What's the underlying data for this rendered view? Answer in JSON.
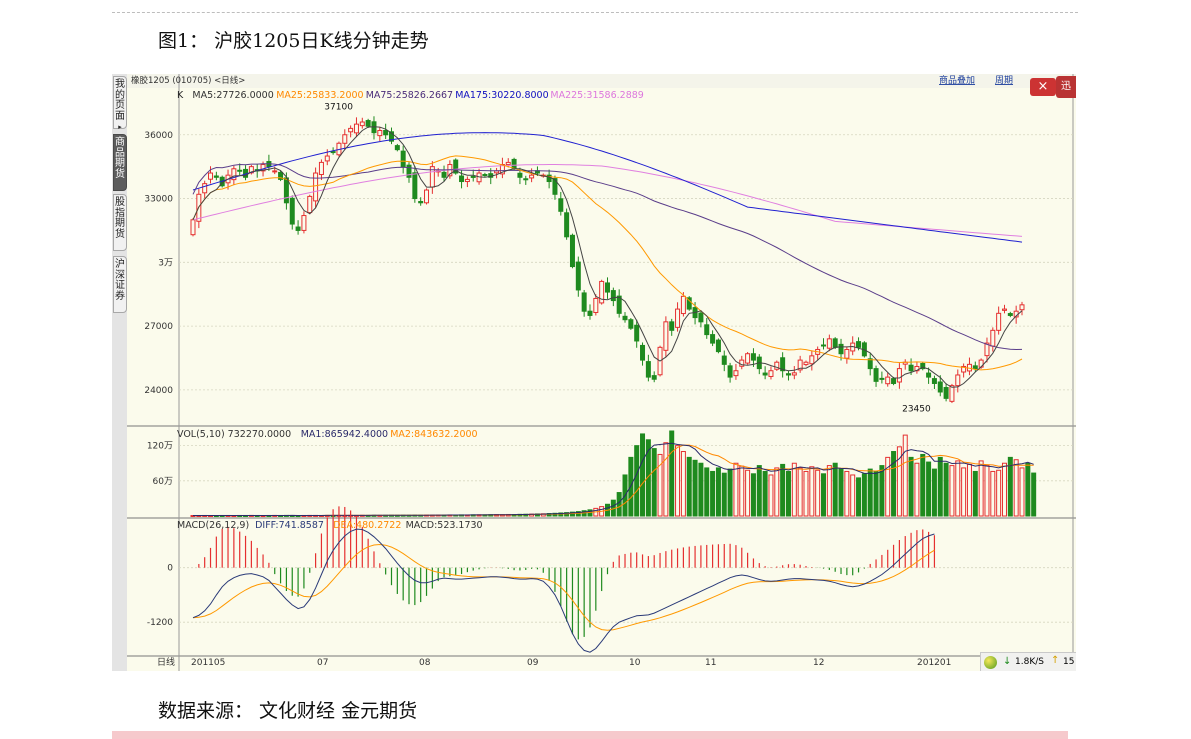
{
  "figure_title": "图1：  沪胶1205日K线分钟走势",
  "source_text": "数据来源：  文化财经    金元期货",
  "window": {
    "title": "橡胶1205 (010705) <日线>",
    "menu": [
      "商品叠加",
      "周期"
    ],
    "close_label": "×",
    "side_label": "迅"
  },
  "left_tabs": [
    {
      "label": "我的页面",
      "active": false,
      "arrow": "▸"
    },
    {
      "label": "商品期货",
      "active": true,
      "arrow": ""
    },
    {
      "label": "股指期货",
      "active": false,
      "arrow": ""
    },
    {
      "label": "沪深证券",
      "active": false,
      "arrow": ""
    }
  ],
  "status": {
    "speed": "1.8K/S",
    "up": "15",
    "down_arrow": "↓",
    "up_arrow": "↑"
  },
  "colors": {
    "up": "#e53030",
    "down": "#1f8a1f",
    "ma5": "#444444",
    "ma25": "#ff9900",
    "ma75": "#5a3d8a",
    "ma175": "#2020d0",
    "ma225": "#e080e0",
    "diff": "#2a3a78",
    "dea": "#ff9900",
    "background": "#fbfbec"
  },
  "chart_data": [
    {
      "type": "candlestick",
      "title": "",
      "legend": [
        {
          "prefix": "K",
          "name": "",
          "color": "#222222"
        },
        {
          "name": "MA5:27726.0000",
          "color": "#333333"
        },
        {
          "name": "MA25:25833.2000",
          "color": "#ff8800"
        },
        {
          "name": "MA75:25826.2667",
          "color": "#4b2d7a"
        },
        {
          "name": "MA175:30220.8000",
          "color": "#1010c0"
        },
        {
          "name": "MA225:31586.2889",
          "color": "#dd77dd"
        }
      ],
      "y_ticks": [
        "36000",
        "33000",
        "3万",
        "27000",
        "24000"
      ],
      "ylim": [
        22300,
        38200
      ],
      "annotations": [
        "37100",
        "23450"
      ],
      "high": 37100,
      "low": 23450,
      "closes": [
        32000,
        33200,
        33700,
        34200,
        34000,
        33600,
        34100,
        34400,
        34300,
        34000,
        34500,
        34300,
        34600,
        34500,
        34300,
        33900,
        32800,
        31800,
        31500,
        32200,
        33100,
        34200,
        34700,
        35000,
        35200,
        35600,
        36000,
        36300,
        36500,
        36600,
        36400,
        36100,
        36200,
        36000,
        35700,
        35300,
        34500,
        34000,
        33000,
        32800,
        33400,
        34500,
        34300,
        34000,
        34600,
        34200,
        33800,
        33900,
        34000,
        34200,
        34100,
        34000,
        34300,
        34600,
        34700,
        34400,
        34000,
        33900,
        34100,
        34200,
        34100,
        33800,
        33200,
        32400,
        31200,
        29800,
        28700,
        27700,
        27500,
        28300,
        29100,
        28600,
        28200,
        27600,
        27300,
        26900,
        26300,
        25400,
        24600,
        24500,
        26000,
        27200,
        26800,
        27800,
        28400,
        27800,
        27400,
        27200,
        26600,
        26200,
        25800,
        25200,
        24600,
        24900,
        25400,
        25700,
        25400,
        25000,
        24700,
        24900,
        25300,
        24900,
        24700,
        24800,
        25400,
        25300,
        25600,
        25900,
        26100,
        26400,
        26000,
        25700,
        25900,
        26200,
        26000,
        25600,
        25000,
        24400,
        24500,
        24600,
        24300,
        25000,
        25300,
        24900,
        25100,
        25000,
        24600,
        24300,
        23900,
        23600,
        24200,
        24700,
        25100,
        25200,
        25000,
        25400,
        26200,
        26800,
        27600,
        27800,
        27500,
        27700,
        28000
      ]
    },
    {
      "type": "bar",
      "title": "",
      "legend": [
        {
          "name": "VOL(5,10) 732270.0000",
          "color": "#333333"
        },
        {
          "name": "MA1:865942.4000",
          "color": "#2a2a6a"
        },
        {
          "name": "MA2:843632.2000",
          "color": "#ff8800"
        }
      ],
      "y_ticks": [
        "120万",
        "60万"
      ],
      "ylim": [
        0,
        1450000
      ],
      "values": [
        8000,
        8000,
        9000,
        8000,
        8000,
        9000,
        9000,
        8000,
        9000,
        9000,
        10000,
        9000,
        8000,
        9000,
        10000,
        9000,
        10000,
        9000,
        8000,
        9000,
        10000,
        10000,
        9000,
        10000,
        10000,
        11000,
        10000,
        11000,
        10000,
        12000,
        11000,
        12000,
        11000,
        12000,
        13000,
        12000,
        14000,
        13000,
        15000,
        14000,
        16000,
        15000,
        17000,
        16000,
        18000,
        17000,
        19000,
        18000,
        20000,
        21000,
        20000,
        22000,
        24000,
        23000,
        26000,
        25000,
        28000,
        30000,
        32000,
        35000,
        38000,
        42000,
        46000,
        52000,
        58000,
        66000,
        75000,
        90000,
        105000,
        130000,
        160000,
        200000,
        270000,
        400000,
        700000,
        1000000,
        1200000,
        1400000,
        1300000,
        1150000,
        1050000,
        1250000,
        1450000,
        1200000,
        1100000,
        1000000,
        950000,
        900000,
        820000,
        760000,
        820000,
        730000,
        800000,
        900000,
        850000,
        780000,
        720000,
        860000,
        760000,
        700000,
        820000,
        880000,
        760000,
        900000,
        820000,
        760000,
        840000,
        780000,
        720000,
        860000,
        900000,
        800000,
        760000,
        700000,
        650000,
        720000,
        800000,
        760000,
        860000,
        1000000,
        1100000,
        1180000,
        1380000,
        1000000,
        900000,
        1050000,
        920000,
        800000,
        1000000,
        900000,
        860000,
        940000,
        820000,
        880000,
        760000,
        940000,
        860000,
        760000,
        780000,
        900000,
        1000000,
        960000,
        820000,
        900000,
        732270
      ]
    },
    {
      "type": "bar",
      "title": "",
      "legend": [
        {
          "name": "MACD(26,12,9)",
          "color": "#333333"
        },
        {
          "name": "DIFF:741.8587",
          "color": "#2a3a78"
        },
        {
          "name": "DEA:480.2722",
          "color": "#ff8800"
        },
        {
          "name": "MACD:523.1730",
          "color": "#333333"
        }
      ],
      "y_ticks": [
        "0",
        "-1200"
      ],
      "ylim": [
        -1900,
        1050
      ],
      "diff": [
        -1100,
        -1050,
        -950,
        -800,
        -600,
        -420,
        -300,
        -220,
        -170,
        -140,
        -130,
        -160,
        -200,
        -280,
        -420,
        -560,
        -700,
        -820,
        -900,
        -860,
        -700,
        -450,
        -150,
        150,
        380,
        560,
        700,
        800,
        850,
        840,
        780,
        680,
        560,
        420,
        260,
        100,
        -50,
        -180,
        -280,
        -330,
        -330,
        -300,
        -250,
        -230,
        -240,
        -250,
        -250,
        -240,
        -230,
        -220,
        -210,
        -200,
        -200,
        -210,
        -220,
        -240,
        -250,
        -250,
        -240,
        -250,
        -300,
        -420,
        -600,
        -850,
        -1150,
        -1450,
        -1680,
        -1820,
        -1860,
        -1780,
        -1620,
        -1450,
        -1300,
        -1200,
        -1150,
        -1100,
        -1060,
        -1050,
        -1040,
        -1000,
        -940,
        -880,
        -820,
        -760,
        -700,
        -640,
        -580,
        -520,
        -460,
        -400,
        -340,
        -280,
        -220,
        -180,
        -160,
        -180,
        -220,
        -260,
        -290,
        -300,
        -290,
        -270,
        -250,
        -240,
        -240,
        -250,
        -260,
        -270,
        -280,
        -300,
        -330,
        -370,
        -400,
        -420,
        -400,
        -360,
        -300,
        -230,
        -150,
        -50,
        60,
        180,
        300,
        420,
        540,
        640,
        700,
        741.8587
      ]
    }
  ],
  "x_axis": {
    "labels": [
      "日线",
      "201105",
      "07",
      "08",
      "09",
      "10",
      "11",
      "12",
      "201201"
    ]
  }
}
